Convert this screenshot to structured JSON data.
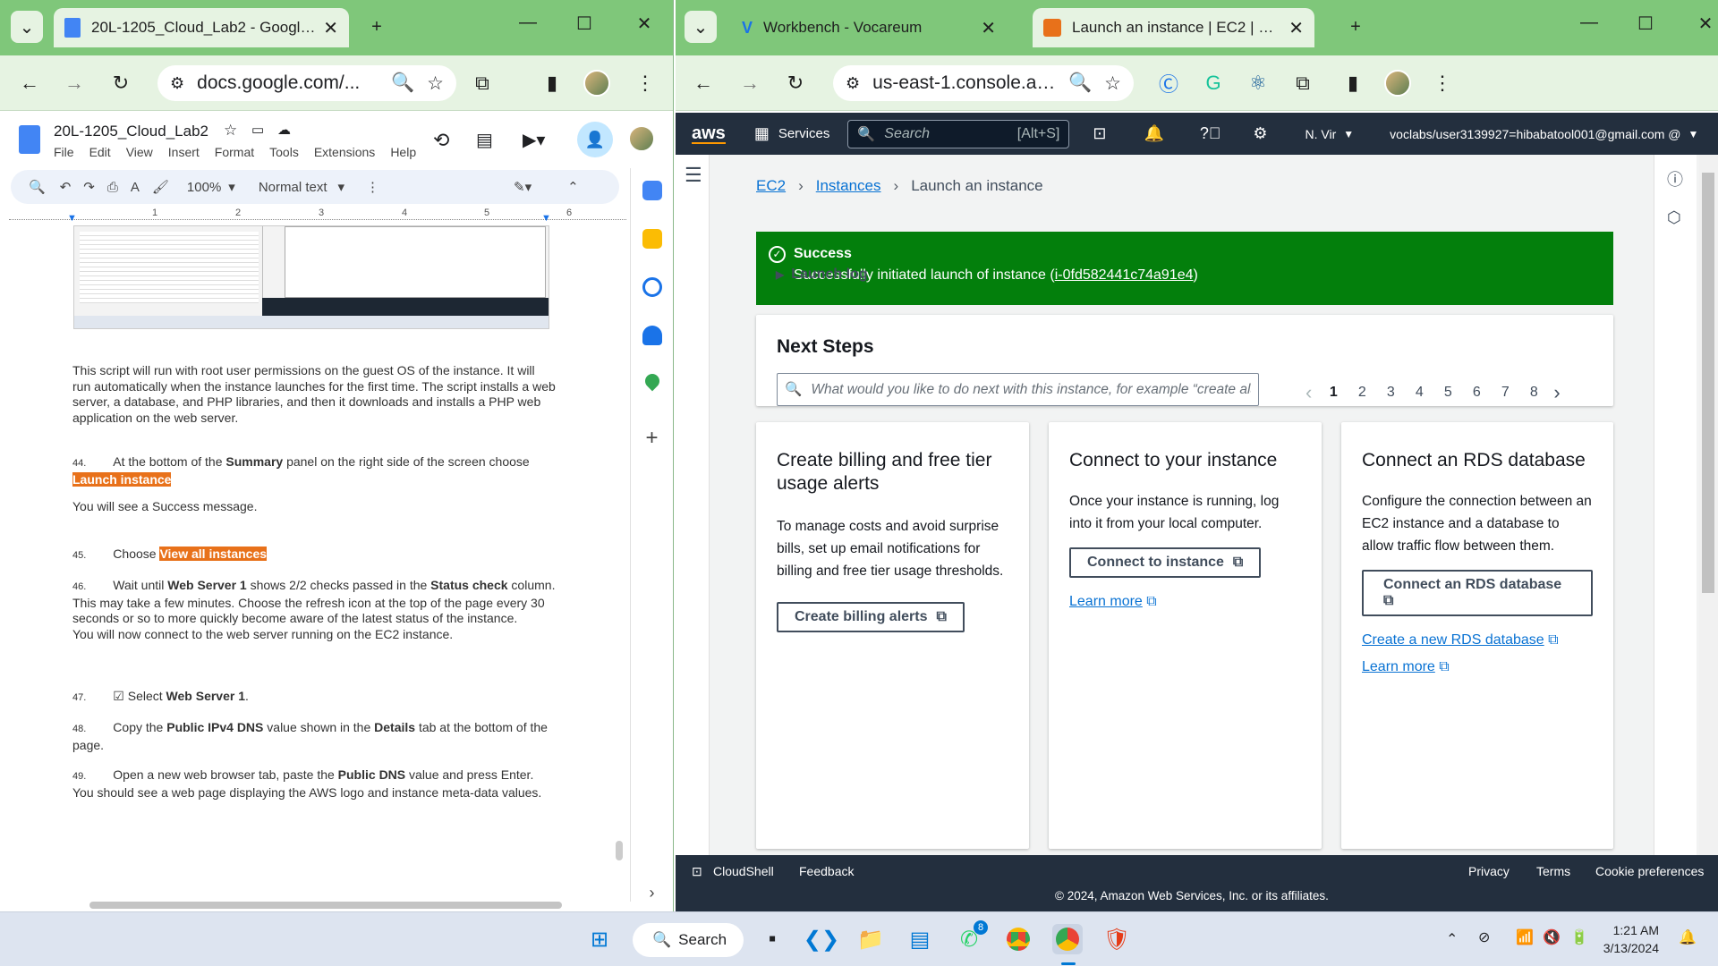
{
  "left_window": {
    "tab_title": "20L-1205_Cloud_Lab2 - Google Do",
    "url": "docs.google.com/...",
    "doc": {
      "title": "20L-1205_Cloud_Lab2",
      "menu": [
        "File",
        "Edit",
        "View",
        "Insert",
        "Format",
        "Tools",
        "Extensions",
        "Help"
      ],
      "zoom": "100%",
      "style": "Normal text",
      "ruler_ticks": [
        "1",
        "2",
        "3",
        "4",
        "5",
        "6"
      ],
      "para_script": "This script will run with root user permissions on the guest OS of the instance. It will run automatically when the instance launches for the first time. The script installs a web server, a database, and PHP libraries, and then it downloads and installs a PHP web application on the web server.",
      "step44_num": "44.",
      "step44_pre": "At the bottom of the ",
      "step44_bold": "Summary",
      "step44_post": " panel on the right side of the screen choose ",
      "step44_hl": "Launch instance",
      "success_msg": "You will see a Success message.",
      "step45_num": "45.",
      "step45_pre": "Choose ",
      "step45_hl": "View all instances",
      "step46_num": "46.",
      "step46_pre": "Wait until ",
      "step46_bold1": "Web Server 1",
      "step46_mid": " shows 2/2 checks passed in the ",
      "step46_bold2": "Status check",
      "step46_post": " column.",
      "step46_l2": "This may take a few minutes. Choose the refresh icon at the top of the page every 30 seconds or so to more quickly become aware of the latest status of the instance.",
      "step46_l3": "You will now connect to the web server running on the EC2 instance.",
      "step47_num": "47.",
      "step47_pre": "☑ Select ",
      "step47_bold": "Web Server 1",
      "step47_post": ".",
      "step48_num": "48.",
      "step48_pre": "Copy the ",
      "step48_bold1": "Public IPv4 DNS",
      "step48_mid": " value shown in the ",
      "step48_bold2": "Details",
      "step48_post": " tab at the bottom of the page.",
      "step49_num": "49.",
      "step49_pre": "Open a new web browser tab, paste the ",
      "step49_bold": "Public DNS",
      "step49_post": " value and press Enter.",
      "step49_l2": "You should see a web page displaying the AWS logo and instance meta-data values."
    }
  },
  "right_window": {
    "tab1_title": "Workbench - Vocareum",
    "tab2_title": "Launch an instance | EC2 | us-east",
    "url": "us-east-1.console.aws.amazon.com/ec2/home?...",
    "aws": {
      "logo": "aws",
      "services": "Services",
      "search_placeholder": "Search",
      "search_shortcut": "[Alt+S]",
      "region": "N. Vir",
      "account": "voclabs/user3139927=hibabatool001@gmail.com @",
      "breadcrumb": [
        "EC2",
        "Instances",
        "Launch an instance"
      ],
      "success_title": "Success",
      "success_text": "Successfully initiated launch of instance (",
      "instance_id": "i-0fd582441c74a91e4",
      "success_close": ")",
      "launch_log": "Launch log",
      "next_steps": "Next Steps",
      "next_search_placeholder": "What would you like to do next with this instance, for example “create alarm” or “create backup”",
      "pages": [
        "1",
        "2",
        "3",
        "4",
        "5",
        "6",
        "7",
        "8"
      ],
      "cards": [
        {
          "title": "Create billing and free tier usage alerts",
          "text": "To manage costs and avoid surprise bills, set up email notifications for billing and free tier usage thresholds.",
          "button": "Create billing alerts"
        },
        {
          "title": "Connect to your instance",
          "text": "Once your instance is running, log into it from your local computer.",
          "button": "Connect to instance",
          "link": "Learn more"
        },
        {
          "title": "Connect an RDS database",
          "text": "Configure the connection between an EC2 instance and a database to allow traffic flow between them.",
          "button": "Connect an RDS database",
          "link1": "Create a new RDS database",
          "link2": "Learn more"
        }
      ],
      "footer": {
        "cloudshell": "CloudShell",
        "feedback": "Feedback",
        "privacy": "Privacy",
        "terms": "Terms",
        "cookies": "Cookie preferences",
        "copyright": "© 2024, Amazon Web Services, Inc. or its affiliates."
      }
    }
  },
  "taskbar": {
    "search": "Search",
    "time": "1:21 AM",
    "date": "3/13/2024",
    "whatsapp_badge": "8"
  }
}
